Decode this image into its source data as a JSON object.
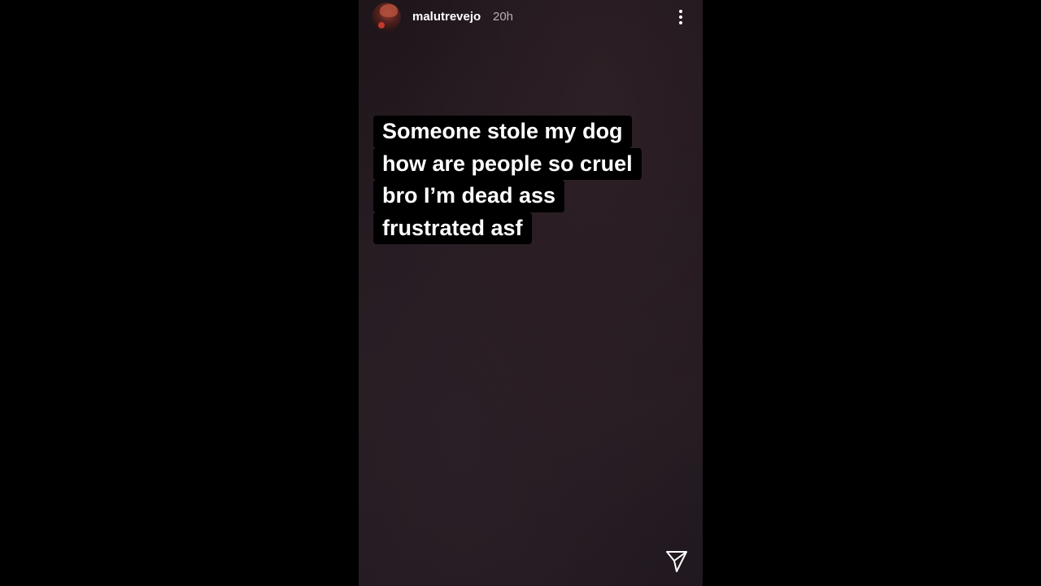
{
  "story": {
    "username": "malutrevejo",
    "timestamp": "20h",
    "more_icon": "more-vertical-icon",
    "send_icon": "send-paper-plane-icon",
    "text_lines": [
      "Someone stole my dog",
      "how are people so cruel",
      "bro I’m dead ass",
      "frustrated asf"
    ]
  },
  "colors": {
    "page_background": "#000000",
    "story_background": "#221920",
    "text_highlight": "#000000",
    "text": "#ffffff",
    "timestamp": "#b7b1b4"
  }
}
